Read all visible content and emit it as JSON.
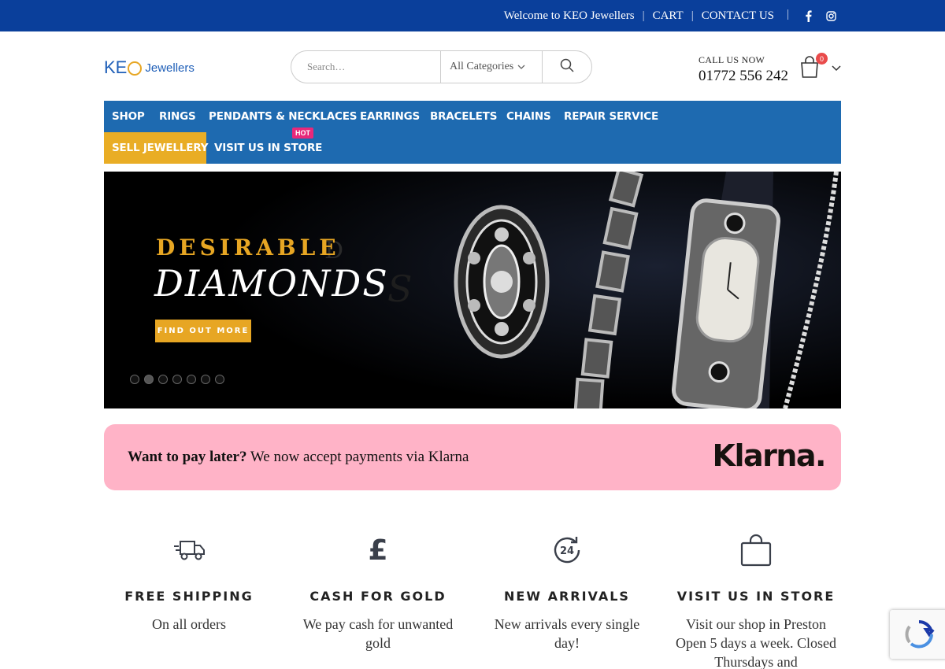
{
  "topbar": {
    "welcome": "Welcome to KEO Jewellers",
    "separator": "|",
    "cart": "CART",
    "contact": "CONTACT US",
    "facebook_glyph": "f",
    "instagram_glyph": "◎"
  },
  "header": {
    "logo_keo": "KE",
    "logo_jewellers": "Jewellers",
    "search_placeholder": "Search…",
    "category": "All Categories",
    "call_label": "CALL US NOW",
    "phone": "01772 556 242",
    "cart_count": "0"
  },
  "nav": {
    "row1": [
      "SHOP",
      "RINGS",
      "PENDANTS & NECKLACES",
      "EARRINGS",
      "BRACELETS",
      "CHAINS",
      "REPAIR SERVICE"
    ],
    "sell": "SELL JEWELLERY",
    "visit": "VISIT US IN STORE",
    "hot": "HOT"
  },
  "hero": {
    "title1": "DESIRABLE",
    "title2": "DIAMONDS",
    "button": "FIND OUT MORE",
    "slide_count": 7,
    "active_slide": 2
  },
  "klarna": {
    "bold": "Want to pay later?",
    "text": "We now accept payments via Klarna",
    "logo": "Klarna."
  },
  "features": [
    {
      "icon": "delivery-truck-icon",
      "title": "FREE SHIPPING",
      "desc": "On all orders"
    },
    {
      "icon": "pound-sign-icon",
      "title": "CASH FOR GOLD",
      "desc": "We pay cash for unwanted gold"
    },
    {
      "icon": "24-hours-icon",
      "title": "NEW ARRIVALS",
      "desc": "New arrivals every single day!"
    },
    {
      "icon": "shopping-bag-icon",
      "title": "VISIT US IN STORE",
      "desc": "Visit our shop in Preston Open 5 days a week. Closed Thursdays and"
    }
  ],
  "colors": {
    "topbar": "#0a3f9b",
    "nav": "#1e6ab0",
    "accent_gold": "#e7a623",
    "klarna_pink": "#ffb3c7",
    "hot_pink": "#e8287a"
  }
}
